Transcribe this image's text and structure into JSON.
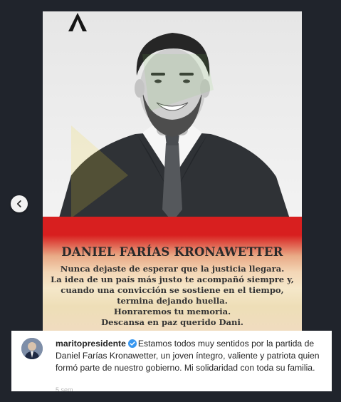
{
  "post": {
    "heading": "DANIEL FARÍAS KRONAWETTER",
    "tribute_lines": [
      "Nunca dejaste de esperar que la justicia llegara.",
      "La idea de un país más justo te acompañó siempre y,",
      "cuando una convicción se sostiene en el tiempo,",
      "termina dejando huella.",
      "Honraremos tu memoria.",
      "Descansa en paz querido Dani."
    ],
    "flag_colors": [
      "#d81f1f",
      "#f5e7c9"
    ]
  },
  "caption": {
    "username": "maritopresidente",
    "text": "Estamos todos muy sentidos por la partida de Daniel Farías Kronawetter, un joven íntegro, valiente y patriota quien formó parte de nuestro gobierno. Mi solidaridad con toda su familia.",
    "more": "5 sem"
  },
  "icons": {
    "previous": "chevron-left-icon",
    "mourning": "mourning-ribbon-icon",
    "verified": "verified-badge-icon"
  },
  "colors": {
    "background": "#20242c",
    "verified": "#3897f0"
  }
}
